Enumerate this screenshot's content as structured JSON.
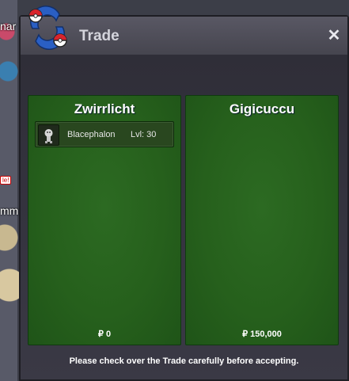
{
  "background": {
    "npc_label_1": "nar",
    "npc_label_2": "mm",
    "npc_badge": "le!"
  },
  "window": {
    "title": "Trade",
    "close_icon": "close-icon",
    "logo_icon": "trade-pokeball-icon"
  },
  "left_panel": {
    "name": "Zwirrlicht",
    "money": "₽ 0",
    "pokemon": [
      {
        "name": "Blacephalon",
        "level": "Lvl: 30",
        "icon": "blacephalon-sprite-icon"
      }
    ]
  },
  "right_panel": {
    "name": "Gigicuccu",
    "money": "₽ 150,000"
  },
  "notice": "Please check over the Trade carefully before accepting.",
  "colors": {
    "panel_green": "#26601c",
    "window_bg": "#373640",
    "title_text": "#d4d4dc"
  }
}
